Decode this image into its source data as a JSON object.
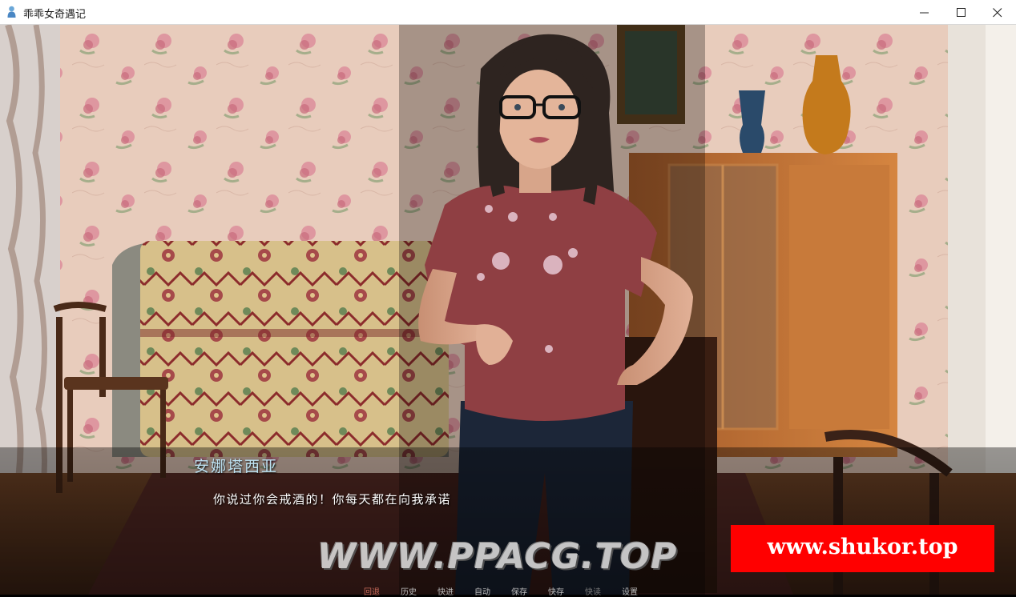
{
  "window": {
    "title": "乖乖女奇遇记",
    "icon": "app-person-icon",
    "controls": [
      "minimize-icon",
      "maximize-icon",
      "close-icon"
    ]
  },
  "dialogue": {
    "speaker": "安娜塔西亚",
    "text": "你说过你会戒酒的！你每天都在向我承诺"
  },
  "watermarks": {
    "left": "WWW.PPACG.TOP",
    "right": "www.shukor.top"
  },
  "quick_menu": [
    {
      "label": "回退",
      "state": "active"
    },
    {
      "label": "历史",
      "state": "normal"
    },
    {
      "label": "快进",
      "state": "normal"
    },
    {
      "label": "自动",
      "state": "normal"
    },
    {
      "label": "保存",
      "state": "normal"
    },
    {
      "label": "快存",
      "state": "normal"
    },
    {
      "label": "快读",
      "state": "dim"
    },
    {
      "label": "设置",
      "state": "normal"
    }
  ],
  "colors": {
    "speaker": "#bfe3f3",
    "watermark_badge": "#ff0000",
    "wallpaper": "#e6c7b6"
  }
}
